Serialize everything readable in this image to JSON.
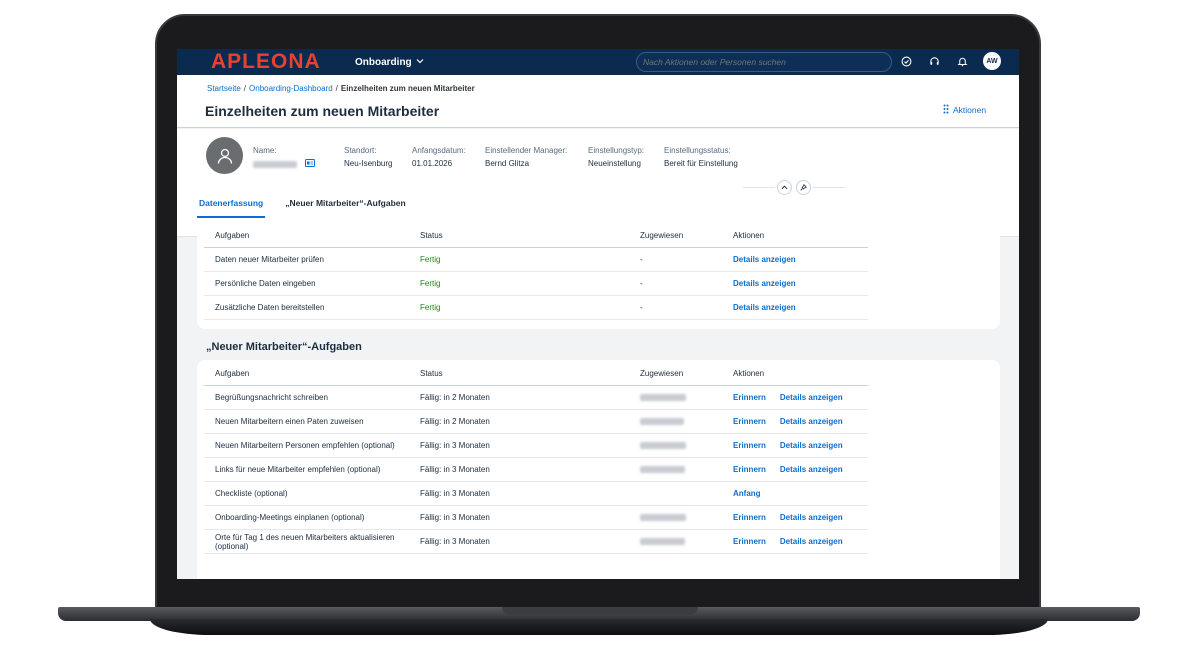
{
  "shell": {
    "logo": "APLEONA",
    "app_menu": "Onboarding",
    "search_placeholder": "Nach Aktionen oder Personen suchen",
    "avatar_initials": "AW"
  },
  "breadcrumb": {
    "items": [
      "Startseite",
      "Onboarding-Dashboard"
    ],
    "separator": "/",
    "current": "Einzelheiten zum neuen Mitarbeiter"
  },
  "page": {
    "title": "Einzelheiten zum neuen Mitarbeiter",
    "actions_label": "Aktionen"
  },
  "employee": {
    "fields": [
      {
        "label": "Name:",
        "value": ""
      },
      {
        "label": "Standort:",
        "value": "Neu-Isenburg"
      },
      {
        "label": "Anfangsdatum:",
        "value": "01.01.2026"
      },
      {
        "label": "Einstellender Manager:",
        "value": "Bernd Glitza"
      },
      {
        "label": "Einstellungstyp:",
        "value": "Neueinstellung"
      },
      {
        "label": "Einstellungsstatus:",
        "value": "Bereit für Einstellung"
      }
    ]
  },
  "tabs": [
    {
      "label": "Datenerfassung",
      "active": true
    },
    {
      "label": "„Neuer Mitarbeiter“-Aufgaben",
      "active": false
    }
  ],
  "table_headers": {
    "task": "Aufgaben",
    "status": "Status",
    "assigned": "Zugewiesen",
    "actions": "Aktionen"
  },
  "data_tasks": [
    {
      "task": "Daten neuer Mitarbeiter prüfen",
      "status": "Fertig",
      "assigned": "-",
      "action": "Details anzeigen"
    },
    {
      "task": "Persönliche Daten eingeben",
      "status": "Fertig",
      "assigned": "-",
      "action": "Details anzeigen"
    },
    {
      "task": "Zusätzliche Daten bereitstellen",
      "status": "Fertig",
      "assigned": "-",
      "action": "Details anzeigen"
    }
  ],
  "new_employee_section_title": "„Neuer Mitarbeiter“-Aufgaben",
  "new_employee_tasks": [
    {
      "task": "Begrüßungsnachricht schreiben",
      "status": "Fällig: in 2 Monaten",
      "action1": "Erinnern",
      "action2": "Details anzeigen"
    },
    {
      "task": "Neuen Mitarbeitern einen Paten zuweisen",
      "status": "Fällig: in 2 Monaten",
      "action1": "Erinnern",
      "action2": "Details anzeigen"
    },
    {
      "task": "Neuen Mitarbeitern Personen empfehlen (optional)",
      "status": "Fällig: in 3 Monaten",
      "action1": "Erinnern",
      "action2": "Details anzeigen"
    },
    {
      "task": "Links für neue Mitarbeiter empfehlen (optional)",
      "status": "Fällig: in 3 Monaten",
      "action1": "Erinnern",
      "action2": "Details anzeigen"
    },
    {
      "task": "Checkliste (optional)",
      "status": "Fällig: in 3 Monaten",
      "action1": "Anfang",
      "action2": ""
    },
    {
      "task": "Onboarding-Meetings einplanen (optional)",
      "status": "Fällig: in 3 Monaten",
      "action1": "Erinnern",
      "action2": "Details anzeigen"
    },
    {
      "task": "Orte für Tag 1 des neuen Mitarbeiters aktualisieren (optional)",
      "status": "Fällig: in 3 Monaten",
      "action1": "Erinnern",
      "action2": "Details anzeigen"
    }
  ],
  "colors": {
    "shell": "#0a2a50",
    "logo": "#e8422f",
    "link": "#0a6ed1",
    "positive": "#188918"
  }
}
